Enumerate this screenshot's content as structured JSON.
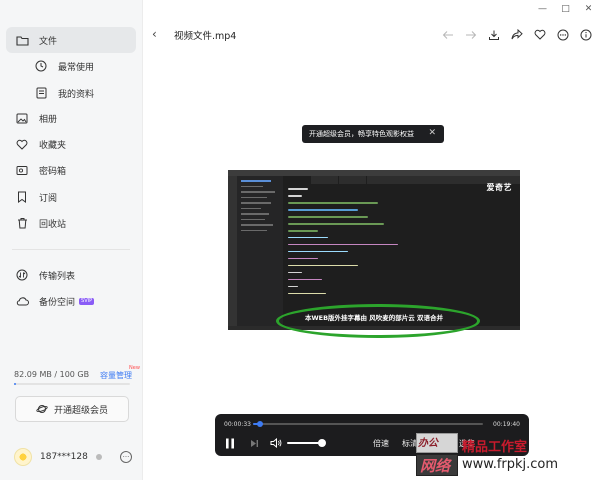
{
  "app": {
    "window_controls": [
      "—",
      "□",
      "✕"
    ]
  },
  "sidebar": {
    "items": [
      {
        "label": "文件",
        "icon": "folder-icon",
        "active": true
      },
      {
        "label": "最常使用",
        "icon": "recent-clock-icon",
        "sub": true
      },
      {
        "label": "我的资料",
        "icon": "document-icon",
        "sub": true
      },
      {
        "label": "相册",
        "icon": "photo-icon"
      },
      {
        "label": "收藏夹",
        "icon": "heart-icon"
      },
      {
        "label": "密码箱",
        "icon": "safe-icon"
      },
      {
        "label": "订阅",
        "icon": "bookmark-icon"
      },
      {
        "label": "回收站",
        "icon": "trash-icon"
      },
      {
        "label": "传输列表",
        "icon": "transfer-icon"
      },
      {
        "label": "备份空间",
        "icon": "cloud-icon",
        "badge": "SVIP"
      }
    ],
    "storage": {
      "text": "82.09 MB / 100 GB",
      "link": "容量管理",
      "link_badge": "New",
      "used_fraction": 0.01
    },
    "vip_button": "开通超级会员",
    "user": {
      "name": "187***128",
      "more": "···"
    }
  },
  "toolbar": {
    "back": "‹",
    "title": "视频文件.mp4",
    "icons": [
      "prev-arrow-icon",
      "next-arrow-icon",
      "download-icon",
      "share-icon",
      "favorite-heart-icon",
      "more-circle-icon",
      "info-icon"
    ]
  },
  "player": {
    "banner": {
      "text": "开通超级会员，畅享特色观影权益",
      "close": "✕"
    },
    "watermark_brand": "爱奇艺",
    "subtitle": "本WEB版外挂字幕由 风吹麦的部片云 双语合并",
    "time_current": "00:00:33",
    "time_total": "00:19:40",
    "progress": 0.03,
    "volume": 0.9,
    "controls": [
      "倍速",
      "标清",
      "字幕",
      "选集"
    ]
  },
  "site_watermark": {
    "top": "办公",
    "bottom": "网络",
    "cn": "精品工作室",
    "url": "www.frpkj.com"
  },
  "colors": {
    "accent": "#3d7bf3",
    "highlight": "#2ca42c",
    "sidebar_bg": "#f5f6f7",
    "player_bg": "#1c1c1e"
  }
}
